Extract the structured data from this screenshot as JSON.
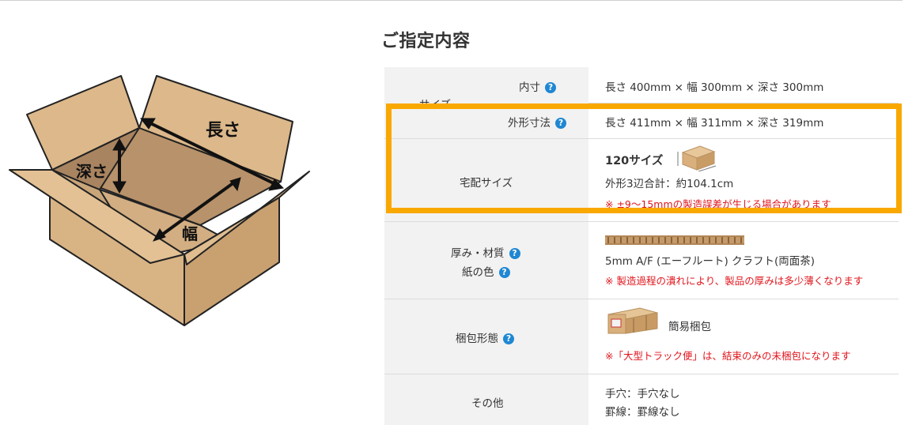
{
  "heading": "ご指定内容",
  "illustration": {
    "length_label": "長さ",
    "depth_label": "深さ",
    "width_label": "幅"
  },
  "spec": {
    "size_group_label": "サイズ",
    "inner": {
      "label": "内寸",
      "value": "長さ 400mm × 幅 300mm × 深さ 300mm"
    },
    "outer": {
      "label": "外形寸法",
      "value": "長さ 411mm × 幅 311mm × 深さ 319mm"
    },
    "delivery": {
      "label": "宅配サイズ",
      "size": "120サイズ",
      "total": "外形3辺合計：約104.1cm",
      "note": "※ ±9〜15mmの製造誤差が生じる場合があります"
    },
    "material": {
      "label1": "厚み・材質",
      "label2": "紙の色",
      "value": "5mm A/F (エーフルート) クラフト(両面茶)",
      "note": "※ 製造過程の潰れにより、製品の厚みは多少薄くなります"
    },
    "packing": {
      "label": "梱包形態",
      "value": "簡易梱包",
      "note": "※「大型トラック便」は、結束のみの未梱包になります"
    },
    "other": {
      "label": "その他",
      "line1": "手穴：手穴なし",
      "line2": "罫線：罫線なし"
    }
  },
  "help_icon_text": "?",
  "colors": {
    "highlight": "#f9a800",
    "note_red": "#e0151c",
    "help_blue": "#1f87d3",
    "label_bg": "#f2f2f2"
  }
}
